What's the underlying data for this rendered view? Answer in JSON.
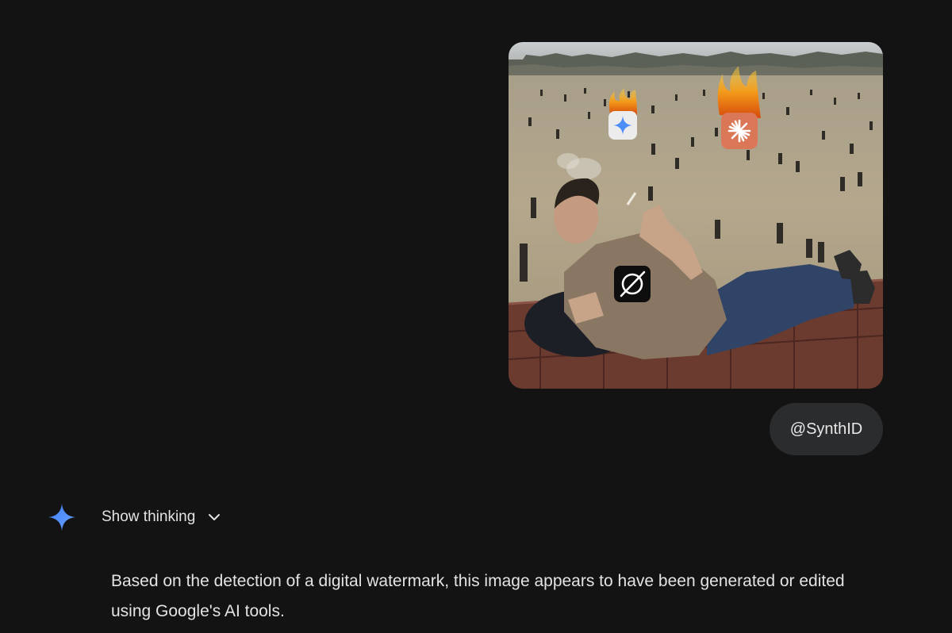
{
  "conversation": {
    "user_message": {
      "image": {
        "subject": "man reclining on a brick ledge smoking, crowded field in background",
        "overlay_icons": [
          "gemini-logo-icon-on-fire",
          "claude-logo-icon-on-fire",
          "grok-logo-icon"
        ]
      },
      "chip_text": "@SynthID"
    },
    "assistant": {
      "icon": "gemini-spark-icon",
      "show_thinking_label": "Show thinking",
      "response_text": "Based on the detection of a digital watermark, this image appears to have been generated or edited using Google's AI tools."
    }
  },
  "colors": {
    "background": "#131314",
    "chip_background": "#2b2c2e",
    "text": "#e3e3e3",
    "gemini_blue": "#4c8df6",
    "claude_orange": "#d97757"
  }
}
